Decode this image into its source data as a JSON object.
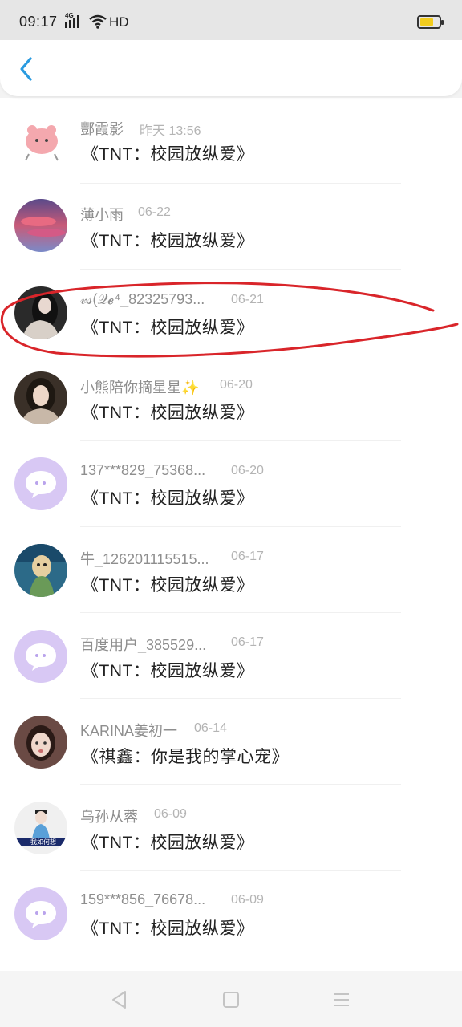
{
  "status_bar": {
    "time": "09:17",
    "network": "4G",
    "hd_label": "HD",
    "battery_color": "#f2cc1d"
  },
  "nav": {
    "back_icon": "chevron-left-icon",
    "accent": "#2a9be0"
  },
  "messages": [
    {
      "name": "酆霞影",
      "date": "昨天 13:56",
      "title": "《TNT：校园放纵爱》",
      "avatar": "pink-bird-avatar"
    },
    {
      "name": "薄小雨",
      "date": "06-22",
      "title": "《TNT：校园放纵爱》",
      "avatar": "sunset-clouds-avatar"
    },
    {
      "name": "𝓋𝓈(𝒬𝓮⁴_82325793...",
      "date": "06-21",
      "title": "《TNT：校园放纵爱》",
      "avatar": "girl-dark-hair-avatar"
    },
    {
      "name": "小熊陪你摘星星✨",
      "date": "06-20",
      "title": "《TNT：校园放纵爱》",
      "avatar": "girl-portrait-avatar"
    },
    {
      "name": "137***829_75368...",
      "date": "06-20",
      "title": "《TNT：校园放纵爱》",
      "avatar": "default-chat-avatar"
    },
    {
      "name": "牛_126201115515...",
      "date": "06-17",
      "title": "《TNT：校园放纵爱》",
      "avatar": "anime-character-avatar"
    },
    {
      "name": "百度用户_385529...",
      "date": "06-17",
      "title": "《TNT：校园放纵爱》",
      "avatar": "default-chat-avatar"
    },
    {
      "name": "KARINA姜初一",
      "date": "06-14",
      "title": "《祺鑫：你是我的掌心宠》",
      "avatar": "girl-crying-avatar"
    },
    {
      "name": "乌孙从蓉",
      "date": "06-09",
      "title": "《TNT：校园放纵爱》",
      "avatar": "boy-sketch-avatar",
      "avatar_caption": "我如何想"
    },
    {
      "name": "159***856_76678...",
      "date": "06-09",
      "title": "《TNT：校园放纵爱》",
      "avatar": "default-chat-avatar"
    }
  ],
  "annotation": {
    "type": "red-hand-drawn-ellipse",
    "color": "#d9252a"
  },
  "system_nav": {
    "back": "triangle-back-icon",
    "home": "square-home-icon",
    "menu": "menu-lines-icon"
  }
}
